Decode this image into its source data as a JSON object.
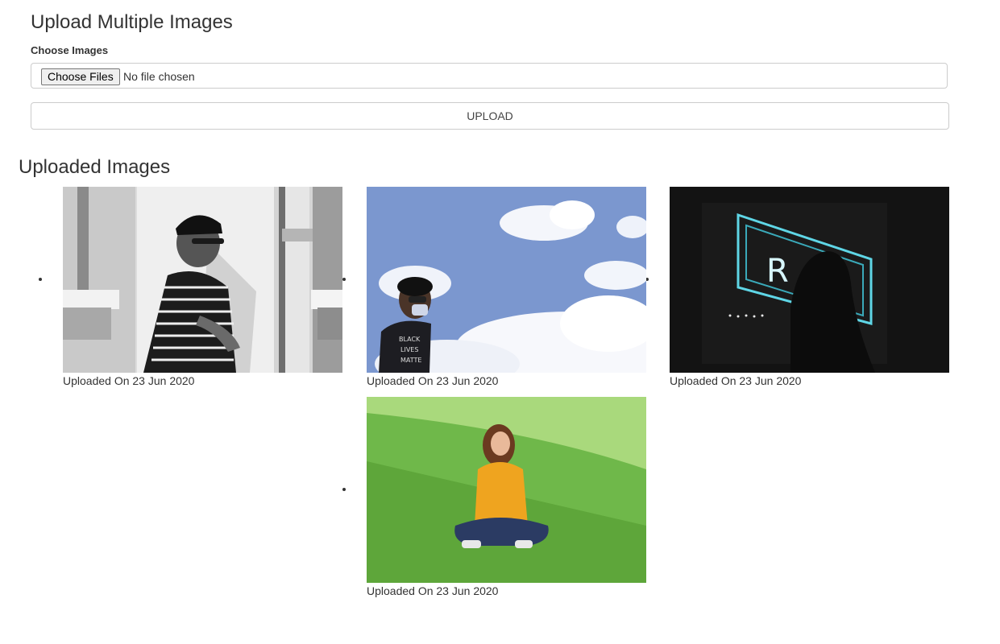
{
  "upload_section": {
    "title": "Upload Multiple Images",
    "choose_label": "Choose Images",
    "file_button_label": "Choose Files",
    "file_status": "No file chosen",
    "upload_button_label": "UPLOAD"
  },
  "gallery": {
    "title": "Uploaded Images",
    "items": [
      {
        "caption": "Uploaded On 23 Jun 2020"
      },
      {
        "caption": "Uploaded On 23 Jun 2020"
      },
      {
        "caption": "Uploaded On 23 Jun 2020"
      },
      {
        "caption": "Uploaded On 23 Jun 2020"
      }
    ]
  }
}
